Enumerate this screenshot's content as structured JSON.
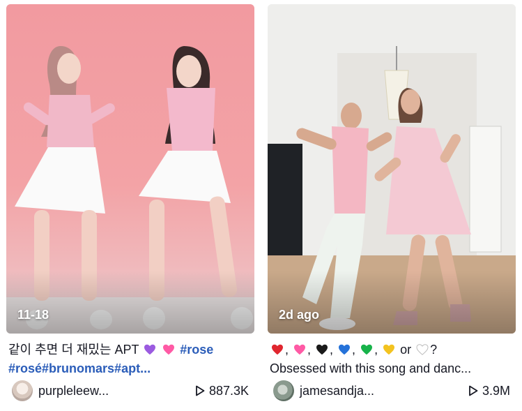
{
  "cards": [
    {
      "date": "11-18",
      "caption_line1_text": "같이 추면 더 재밌는 APT",
      "caption_line1_tag": "#rose",
      "caption_line2_tags": "#rosé#brunomars#apt...",
      "author": "purpleleew...",
      "plays": "887.3K"
    },
    {
      "date": "2d ago",
      "caption_line1_suffix": "or",
      "caption_line1_q": "?",
      "caption_line2": "Obsessed with this song and danc...",
      "author": "jamesandja...",
      "plays": "3.9M"
    }
  ],
  "colors": {
    "hashtag": "#2b5db9",
    "text": "#161823",
    "heart_red": "#e0262f",
    "heart_pink": "#ff5aa5",
    "heart_black": "#1a1a1a",
    "heart_blue": "#2572d9",
    "heart_green": "#17b34a",
    "heart_yellow": "#f3c320",
    "heart_purple": "#9b5be0"
  },
  "icons": [
    "play-icon",
    "heart-icon"
  ]
}
